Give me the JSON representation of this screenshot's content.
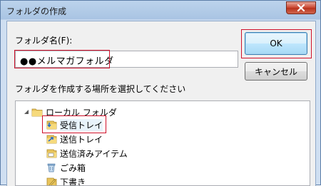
{
  "window": {
    "title": "フォルダの作成"
  },
  "form": {
    "name_label": "フォルダ名(F):",
    "name_value": "●●メルマガフォルダ",
    "location_label": "フォルダを作成する場所を選択してください"
  },
  "buttons": {
    "ok": "OK",
    "cancel": "キャンセル"
  },
  "tree": {
    "root": "ローカル フォルダ",
    "items": [
      {
        "label": "受信トレイ",
        "icon": "inbox-icon",
        "selected": true
      },
      {
        "label": "送信トレイ",
        "icon": "outbox-icon",
        "selected": false
      },
      {
        "label": "送信済みアイテム",
        "icon": "sent-items-icon",
        "selected": false
      },
      {
        "label": "ごみ箱",
        "icon": "trash-icon",
        "selected": false
      },
      {
        "label": "下書き",
        "icon": "drafts-icon",
        "selected": false
      }
    ]
  },
  "colors": {
    "highlight": "#d0112b",
    "title_bg": "#bcd3ec",
    "close_button": "#c9442e"
  }
}
